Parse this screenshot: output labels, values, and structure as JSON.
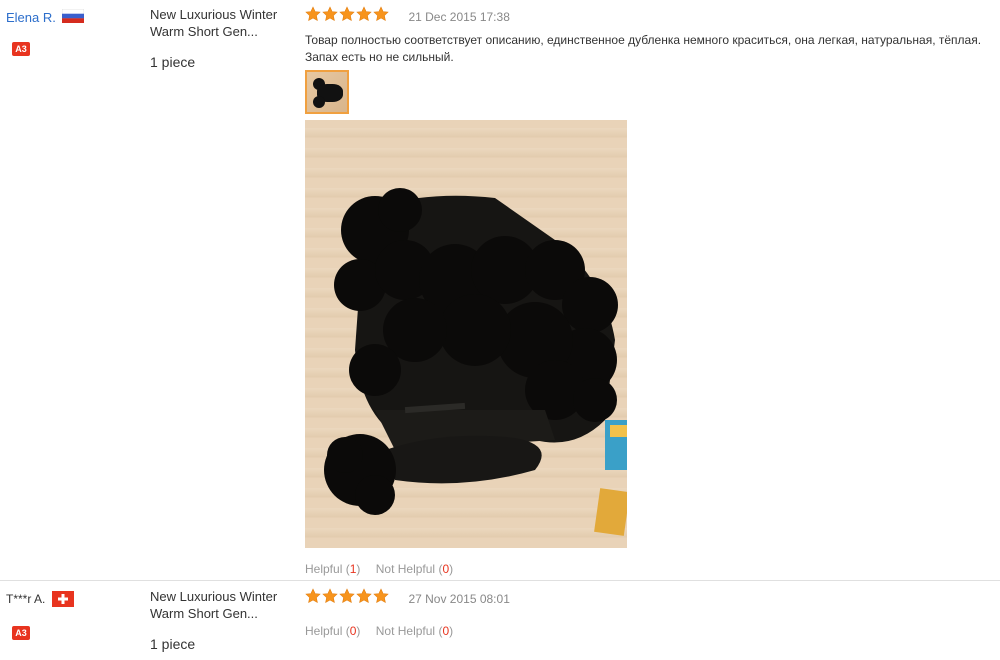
{
  "reviews": [
    {
      "buyer_name": "Elena R.",
      "country": "RU",
      "badge": "A3",
      "product_name": "New Luxurious Winter Warm Short Gen...",
      "quantity": "1 piece",
      "rating": 5,
      "date": "21 Dec 2015 17:38",
      "text": "Товар полностью соответствует описанию, единственное дубленка немного краситься, она легкая, натуральная, тёплая. Запах есть но не сильный.",
      "helpful_label": "Helpful",
      "helpful_count": "1",
      "not_helpful_label": "Not Helpful",
      "not_helpful_count": "0"
    },
    {
      "buyer_name": "T***r A.",
      "country": "CH",
      "badge": "A3",
      "product_name": "New Luxurious Winter Warm Short Gen...",
      "quantity": "1 piece",
      "rating": 5,
      "date": "27 Nov 2015 08:01",
      "helpful_label": "Helpful",
      "helpful_count": "0",
      "not_helpful_label": "Not Helpful",
      "not_helpful_count": "0"
    }
  ],
  "colors": {
    "link": "#2c6ecb",
    "star": "#f7941d",
    "badge": "#e8341f",
    "count": "#e8341f"
  },
  "icons": [
    "russia-flag-icon",
    "switzerland-flag-icon",
    "star-icon"
  ]
}
